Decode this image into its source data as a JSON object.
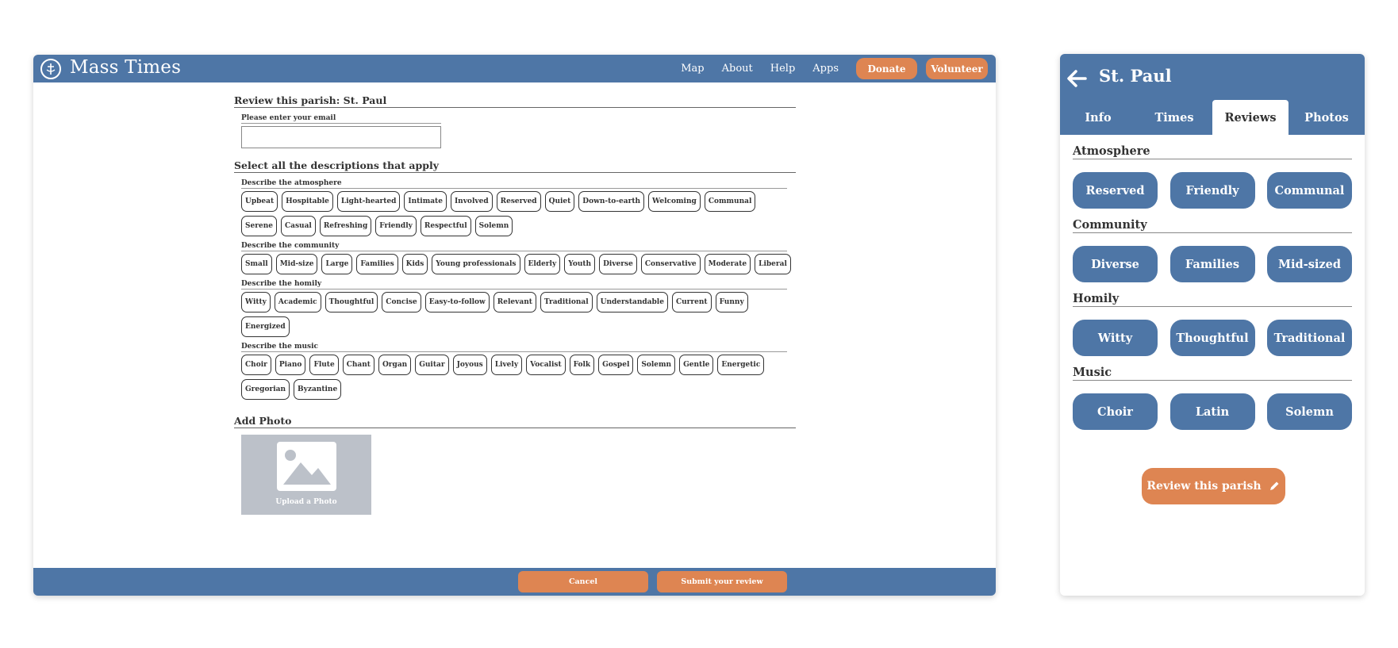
{
  "desktop": {
    "brand": "Mass Times",
    "nav": {
      "map": "Map",
      "about": "About",
      "help": "Help",
      "apps": "Apps",
      "donate": "Donate",
      "volunteer": "Volunteer"
    },
    "form": {
      "review_title": "Review this parish: St. Paul",
      "email_label": "Please enter your email",
      "email_value": "",
      "select_title": "Select all the descriptions that apply",
      "atmosphere_label": "Describe the atmosphere",
      "atmosphere": [
        "Upbeat",
        "Hospitable",
        "Light-hearted",
        "Intimate",
        "Involved",
        "Reserved",
        "Quiet",
        "Down-to-earth",
        "Welcoming",
        "Communal",
        "Serene",
        "Casual",
        "Refreshing",
        "Friendly",
        "Respectful",
        "Solemn"
      ],
      "community_label": "Describe the community",
      "community": [
        "Small",
        "Mid-size",
        "Large",
        "Families",
        "Kids",
        "Young professionals",
        "Elderly",
        "Youth",
        "Diverse",
        "Conservative",
        "Moderate",
        "Liberal"
      ],
      "homily_label": "Describe the homily",
      "homily": [
        "Witty",
        "Academic",
        "Thoughtful",
        "Concise",
        "Easy-to-follow",
        "Relevant",
        "Traditional",
        "Understandable",
        "Current",
        "Funny",
        "Energized"
      ],
      "music_label": "Describe the music",
      "music": [
        "Choir",
        "Piano",
        "Flute",
        "Chant",
        "Organ",
        "Guitar",
        "Joyous",
        "Lively",
        "Vocalist",
        "Folk",
        "Gospel",
        "Solemn",
        "Gentle",
        "Energetic",
        "Gregorian",
        "Byzantine"
      ],
      "photo_title": "Add Photo",
      "photo_label": "Upload a Photo"
    },
    "footer": {
      "cancel": "Cancel",
      "submit": "Submit your review"
    }
  },
  "mobile": {
    "title": "St. Paul",
    "tabs": [
      "Info",
      "Times",
      "Reviews",
      "Photos"
    ],
    "active_tab": "Reviews",
    "categories": [
      {
        "name": "Atmosphere",
        "tags": [
          "Reserved",
          "Friendly",
          "Communal"
        ]
      },
      {
        "name": "Community",
        "tags": [
          "Diverse",
          "Families",
          "Mid-sized"
        ]
      },
      {
        "name": "Homily",
        "tags": [
          "Witty",
          "Thoughtful",
          "Traditional"
        ]
      },
      {
        "name": "Music",
        "tags": [
          "Choir",
          "Latin",
          "Solemn"
        ]
      }
    ],
    "review_button": "Review this parish"
  },
  "colors": {
    "brand_blue": "#4e76a6",
    "accent_orange": "#de8552",
    "photo_placeholder": "#bcc1c9"
  }
}
